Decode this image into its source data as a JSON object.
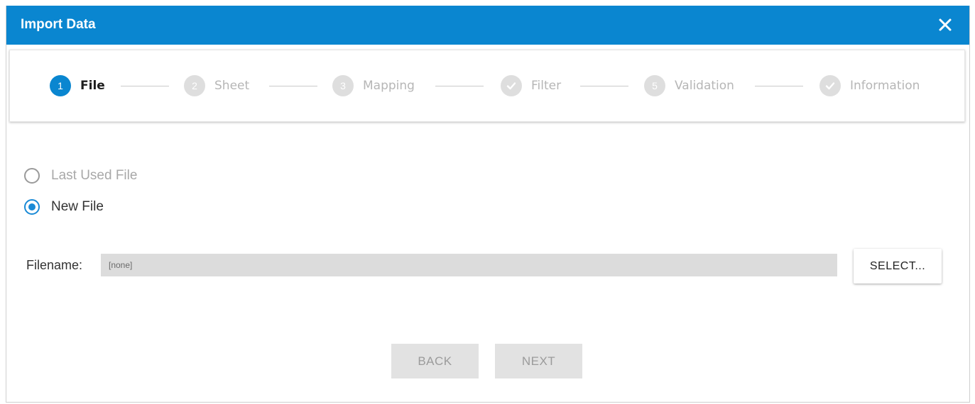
{
  "dialog": {
    "title": "Import Data",
    "close_icon": "close-icon"
  },
  "steps": [
    {
      "marker": "1",
      "label": "File",
      "state": "active"
    },
    {
      "marker": "2",
      "label": "Sheet",
      "state": "inactive"
    },
    {
      "marker": "3",
      "label": "Mapping",
      "state": "inactive"
    },
    {
      "marker": "check-icon",
      "label": "Filter",
      "state": "inactive"
    },
    {
      "marker": "5",
      "label": "Validation",
      "state": "inactive"
    },
    {
      "marker": "check-icon",
      "label": "Information",
      "state": "inactive"
    }
  ],
  "source": {
    "options": [
      {
        "label": "Last Used File",
        "checked": false,
        "enabled": false
      },
      {
        "label": "New File",
        "checked": true,
        "enabled": true
      }
    ]
  },
  "filename": {
    "label": "Filename:",
    "value": "[none]"
  },
  "buttons": {
    "select": "SELECT...",
    "back": "BACK",
    "next": "NEXT"
  },
  "colors": {
    "accent": "#0a86d0",
    "step_inactive": "#dedede",
    "radio_checked": "#1a8ad6",
    "button_disabled_bg": "#e2e2e2"
  }
}
